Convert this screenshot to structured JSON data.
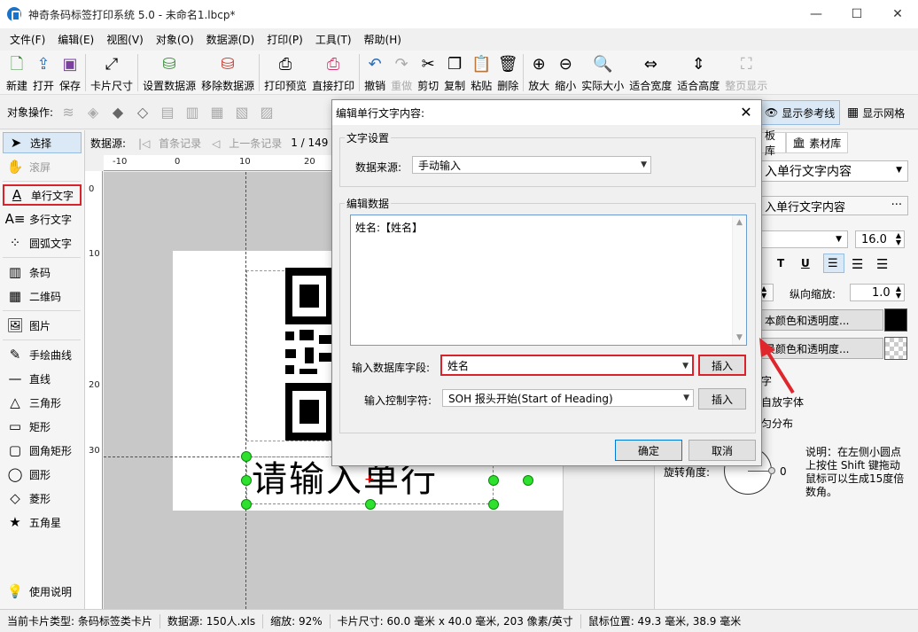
{
  "window": {
    "title": "神奇条码标签打印系统 5.0 - 未命名1.lbcp*",
    "minimize": "—",
    "maximize": "☐",
    "close": "✕"
  },
  "menu": [
    "文件(F)",
    "编辑(E)",
    "视图(V)",
    "对象(O)",
    "数据源(D)",
    "打印(P)",
    "工具(T)",
    "帮助(H)"
  ],
  "toolbar": {
    "new": "新建",
    "open": "打开",
    "save": "保存",
    "card_size": "卡片尺寸",
    "set_datasource": "设置数据源",
    "remove_datasource": "移除数据源",
    "print_preview": "打印预览",
    "direct_print": "直接打印",
    "undo": "撤销",
    "redo": "重做",
    "cut": "剪切",
    "copy": "复制",
    "paste": "粘贴",
    "delete": "删除",
    "zoom_in": "放大",
    "zoom_out": "缩小",
    "actual_size": "实际大小",
    "fit_width": "适合宽度",
    "fit_height": "适合高度",
    "fit_page": "整页显示"
  },
  "object_bar": {
    "label": "对象操作:",
    "show_guides": "显示参考线",
    "show_grid": "显示网格"
  },
  "left_tools": {
    "select": "选择",
    "scroll": "滚屏",
    "single_text": "单行文字",
    "multi_text": "多行文字",
    "arc_text": "圆弧文字",
    "barcode": "条码",
    "qrcode": "二维码",
    "image": "图片",
    "freehand": "手绘曲线",
    "line": "直线",
    "triangle": "三角形",
    "rect": "矩形",
    "round_rect": "圆角矩形",
    "ellipse": "圆形",
    "diamond": "菱形",
    "star": "五角星",
    "help": "使用说明"
  },
  "navbar": {
    "datasource_label": "数据源:",
    "first": "首条记录",
    "prev": "上一条记录",
    "record": "1 / 149"
  },
  "rulers": {
    "h": [
      "-10",
      "0",
      "10",
      "20"
    ],
    "v": [
      "0",
      "10",
      "20",
      "30"
    ]
  },
  "canvas": {
    "text": "请输入单行"
  },
  "right_panel": {
    "tab1": "板库",
    "tab2": "素材库",
    "content_select": "入单行文字内容",
    "content_field": "入单行文字内容",
    "font_size": "16.0",
    "bold": "T",
    "underline": "U",
    "v_scale_label": "纵向缩放:",
    "v_scale": "1.0",
    "text_color_btn": "本颜色和透明度...",
    "bg_color_btn": "景颜色和透明度...",
    "opt1": "字",
    "opt2": "自放字体",
    "opt3": "匀分布",
    "rotate_label": "旋转角度:",
    "rotate_value": "0",
    "note": "说明：在左侧小圆点上按住 Shift 键拖动鼠标可以生成15度倍数角。",
    "text_color": "#000000"
  },
  "dialog": {
    "title": "编辑单行文字内容:",
    "close": "✕",
    "group_text_settings": "文字设置",
    "datasource_label": "数据来源:",
    "datasource_value": "手动输入",
    "group_edit_data": "编辑数据",
    "content": "姓名:【姓名】",
    "db_field_label": "输入数据库字段:",
    "db_field_value": "姓名",
    "insert1": "插入",
    "control_char_label": "输入控制字符:",
    "control_char_value": "SOH  报头开始(Start of Heading)",
    "insert2": "插入",
    "ok": "确定",
    "cancel": "取消"
  },
  "status": {
    "card_type": "当前卡片类型: 条码标签类卡片",
    "datasource": "数据源: 150人.xls",
    "zoom": "缩放: 92%",
    "card_size": "卡片尺寸: 60.0 毫米 x 40.0 毫米, 203 像素/英寸",
    "mouse_pos": "鼠标位置: 49.3 毫米, 38.9 毫米"
  }
}
